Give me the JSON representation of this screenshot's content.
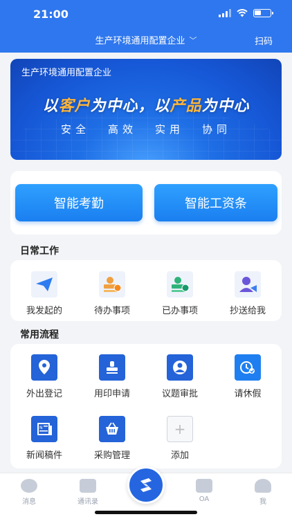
{
  "status_bar": {
    "time": "21:00"
  },
  "header": {
    "org_name": "生产环境通用配置企业",
    "scan_label": "扫码"
  },
  "banner": {
    "org_name": "生产环境通用配置企业",
    "slogan_part1": "以",
    "slogan_hl1": "客户",
    "slogan_part2": "为中心，以",
    "slogan_hl2": "产品",
    "slogan_part3": "为中心",
    "values": [
      "安全",
      "高效",
      "实用",
      "协同"
    ]
  },
  "quick_actions": [
    {
      "label": "智能考勤"
    },
    {
      "label": "智能工资条"
    }
  ],
  "daily_work": {
    "title": "日常工作",
    "items": [
      {
        "label": "我发起的",
        "icon": "paper-plane-icon"
      },
      {
        "label": "待办事项",
        "icon": "pending-stamp-icon"
      },
      {
        "label": "已办事项",
        "icon": "done-stamp-icon"
      },
      {
        "label": "抄送给我",
        "icon": "cc-user-icon"
      }
    ]
  },
  "common_flows": {
    "title": "常用流程",
    "items": [
      {
        "label": "外出登记",
        "icon": "location-pin-icon"
      },
      {
        "label": "用印申请",
        "icon": "seal-icon"
      },
      {
        "label": "议题审批",
        "icon": "user-approval-icon"
      },
      {
        "label": "请休假",
        "icon": "leave-clock-icon"
      },
      {
        "label": "新闻稿件",
        "icon": "news-icon"
      },
      {
        "label": "采购管理",
        "icon": "basket-icon"
      },
      {
        "label": "添加",
        "icon": "plus-icon"
      }
    ]
  },
  "tabbar": {
    "items": [
      {
        "label": "消息"
      },
      {
        "label": "通讯录"
      },
      {
        "label": "OA"
      },
      {
        "label": "我"
      }
    ]
  },
  "colors": {
    "primary": "#2f77ee",
    "accent_orange": "#ffb53a"
  }
}
